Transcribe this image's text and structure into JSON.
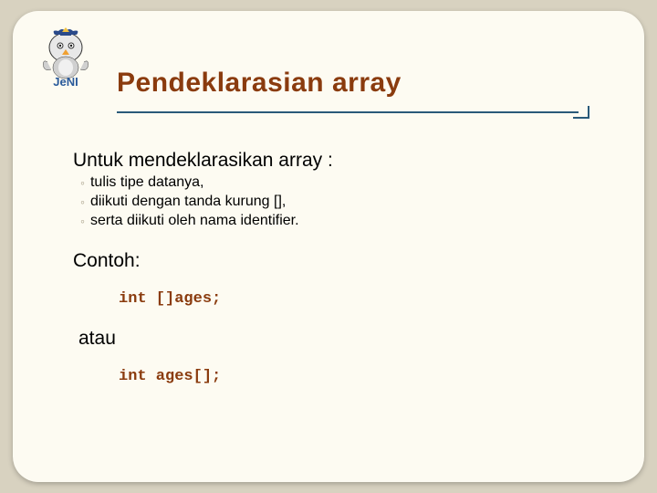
{
  "title": "Pendeklarasian array",
  "lead": "Untuk mendeklarasikan array :",
  "bullets": [
    "tulis tipe datanya,",
    "diikuti dengan tanda kurung [],",
    "serta diikuti oleh nama identifier."
  ],
  "example_label": "Contoh:",
  "code1": "int []ages;",
  "or_label": "atau",
  "code2": "int ages[];",
  "logo_text": "JeNI"
}
